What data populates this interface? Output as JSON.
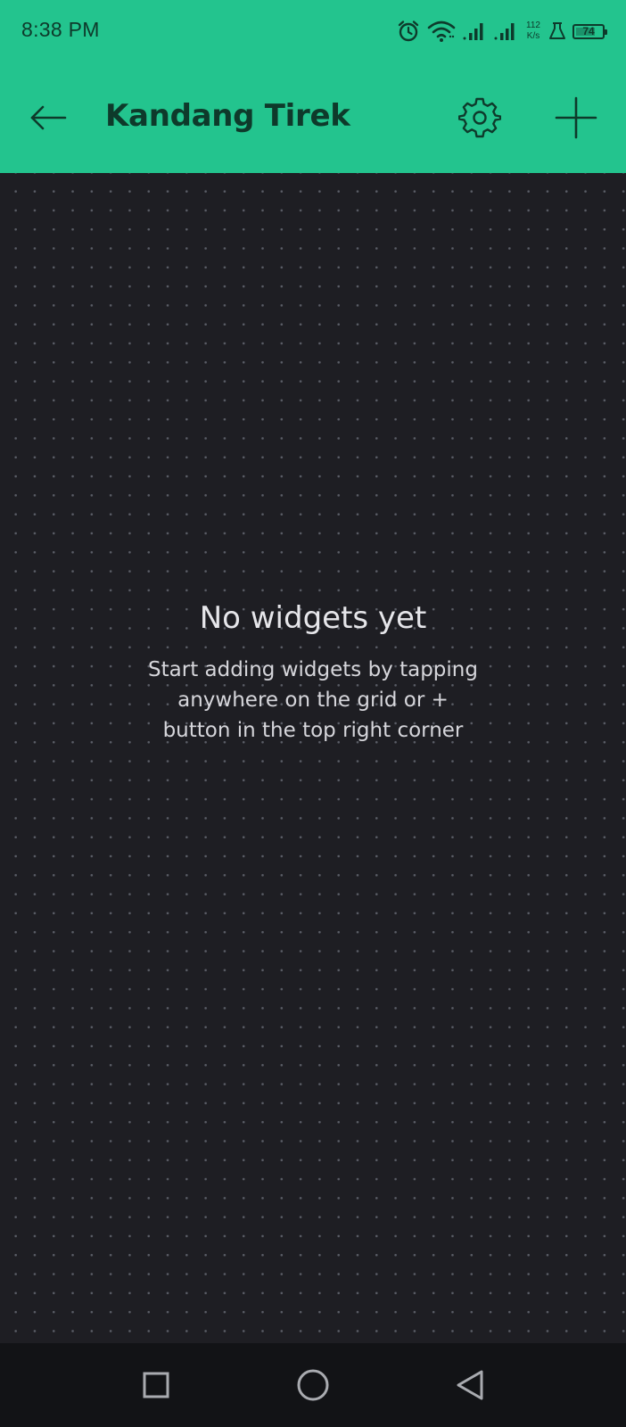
{
  "status_bar": {
    "time": "8:38 PM",
    "net_speed_value": "112",
    "net_speed_unit": "K/s",
    "battery_level": "74",
    "icons": [
      "alarm-icon",
      "wifi-icon",
      "signal-icon",
      "signal-icon",
      "battery-saver-icon",
      "battery-icon"
    ]
  },
  "app_bar": {
    "title": "Kandang Tirek",
    "back_icon": "arrow-left-icon",
    "settings_icon": "gear-icon",
    "add_icon": "plus-icon"
  },
  "empty_state": {
    "title": "No widgets yet",
    "message": "Start adding widgets by tapping anywhere on the grid or + button in the top right corner"
  },
  "nav_bar": {
    "buttons": [
      "recents-square-icon",
      "home-circle-icon",
      "back-triangle-icon"
    ]
  },
  "colors": {
    "accent": "#23c48e",
    "background": "#1e1e23",
    "nav_background": "#121316",
    "header_text": "#0e3a2b",
    "grid_dot": "#5a5d66"
  }
}
